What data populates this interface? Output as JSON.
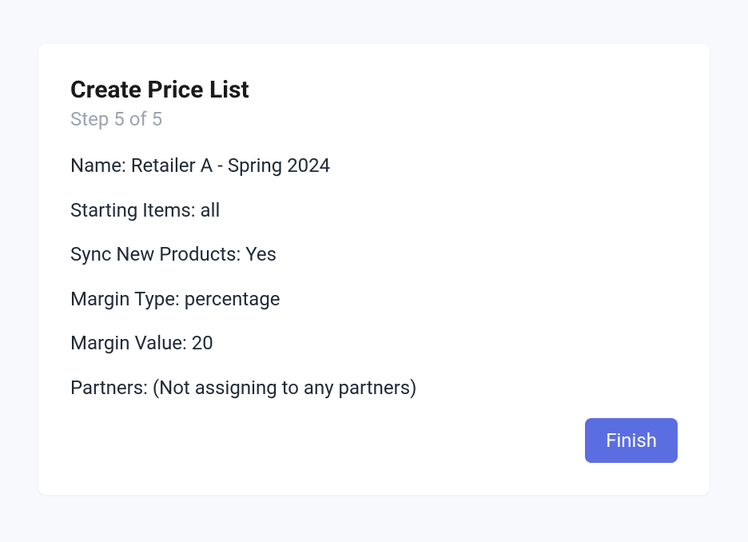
{
  "header": {
    "title": "Create Price List",
    "step_label": "Step 5 of 5"
  },
  "summary": {
    "name": "Name: Retailer A - Spring 2024",
    "starting_items": "Starting Items: all",
    "sync_new_products": "Sync New Products: Yes",
    "margin_type": "Margin Type: percentage",
    "margin_value": "Margin Value: 20",
    "partners": "Partners: (Not assigning to any partners)"
  },
  "actions": {
    "finish_label": "Finish"
  }
}
